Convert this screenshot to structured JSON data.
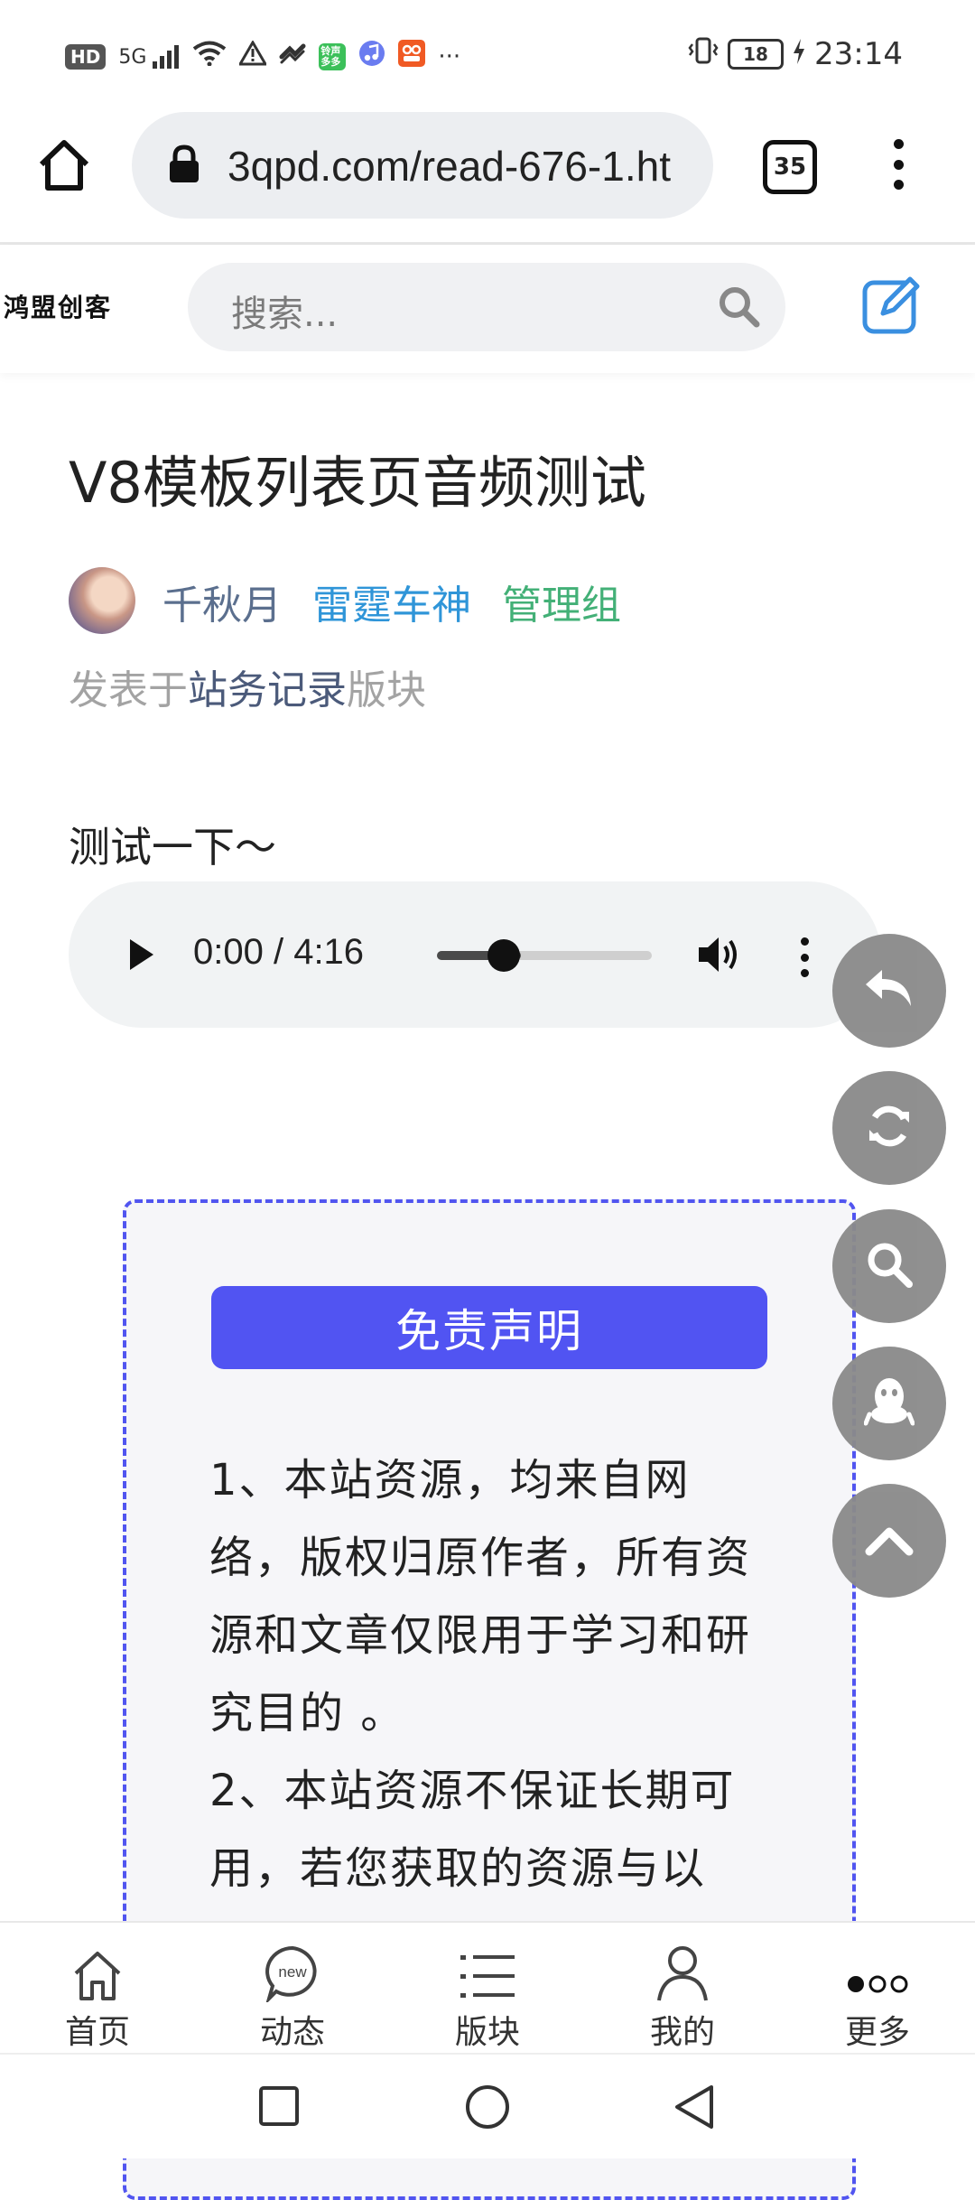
{
  "status_bar": {
    "hd_label": "HD",
    "signal_label": "5G",
    "app_badge_1": "铃声多多",
    "time": "23:14",
    "battery": "18",
    "more": "···"
  },
  "browser": {
    "url": "3qpd.com/read-676-1.ht",
    "tab_count": "35"
  },
  "site": {
    "logo_text": "鸿盟创客",
    "search_placeholder": "搜索..."
  },
  "article": {
    "title": "V8模板列表页音频测试",
    "author": "千秋月",
    "user_group": "雷霆车神",
    "admin_group": "管理组",
    "posted_prefix": "发表于",
    "forum": "站务记录",
    "posted_suffix": "版块",
    "body": "测试一下～"
  },
  "audio": {
    "time_display": "0:00 / 4:16",
    "buffered_fraction": 0.39
  },
  "disclaimer": {
    "title": "免责声明",
    "paragraphs": [
      "1、本站资源，均来自网络，版权归原作者，所有资源和文章仅限用于学习和研究目的 。",
      "2、本站资源不保证长期可用，若您获取的资源与以"
    ]
  },
  "floating_buttons": [
    "reply-icon",
    "refresh-icon",
    "search-icon",
    "qq-icon",
    "chevron-up-icon"
  ],
  "tabbar": {
    "items": [
      {
        "label": "首页",
        "icon": "home-icon"
      },
      {
        "label": "动态",
        "icon": "new-bubble-icon",
        "icon_text": "new"
      },
      {
        "label": "版块",
        "icon": "list-icon"
      },
      {
        "label": "我的",
        "icon": "user-icon"
      },
      {
        "label": "更多",
        "icon": "more-dots-icon"
      }
    ]
  },
  "colors": {
    "accent": "#5154f2",
    "author": "#5b6f8e",
    "user_group": "#2f95d8",
    "admin_group": "#43b077",
    "fab": "#8a8a8a"
  }
}
